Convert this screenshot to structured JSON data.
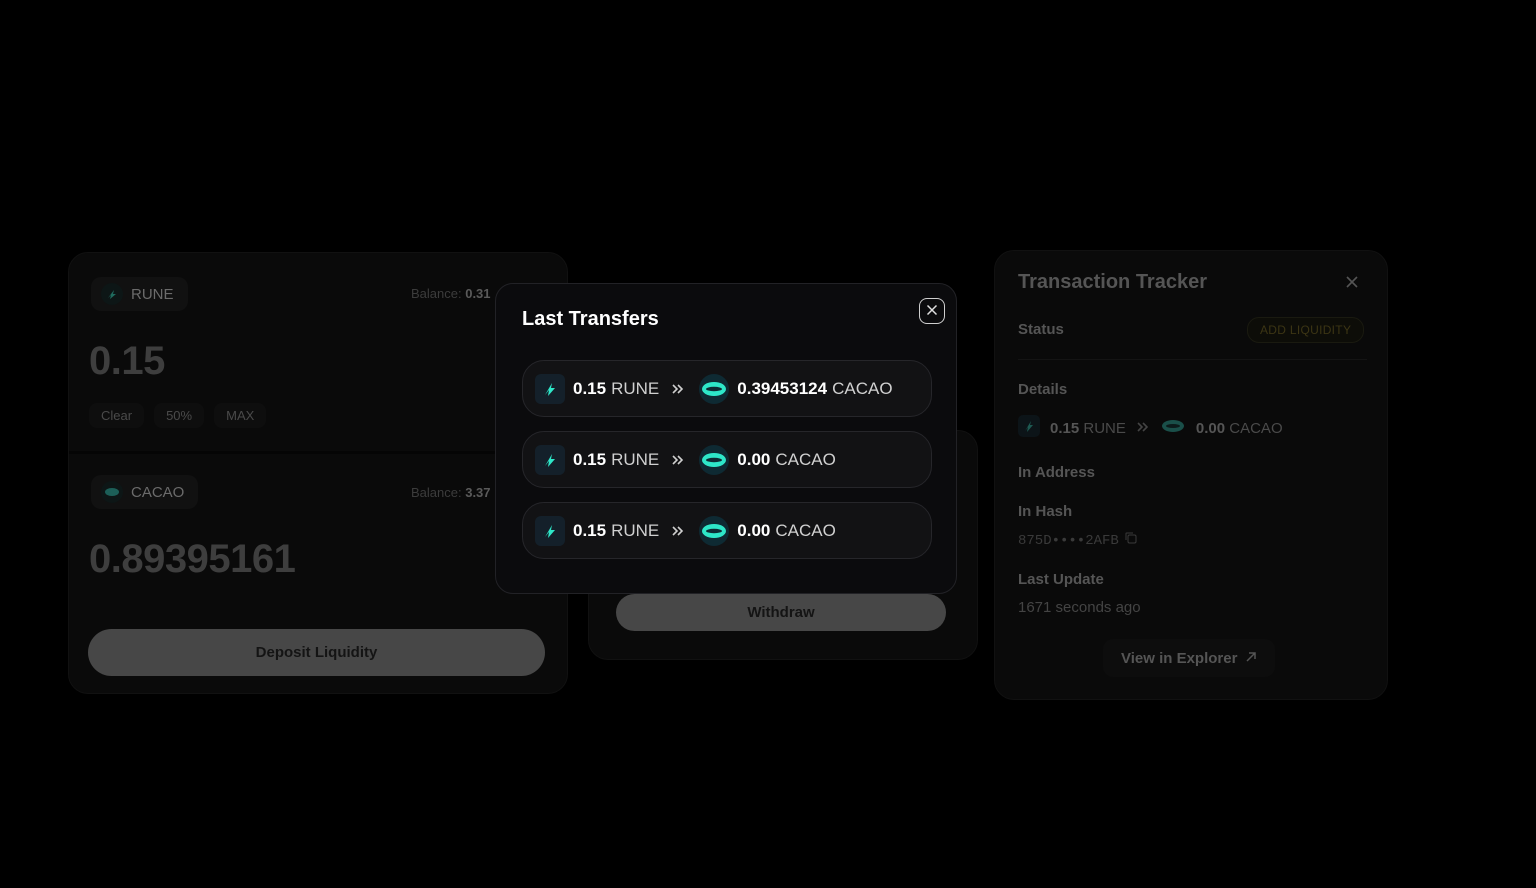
{
  "deposit": {
    "rune_symbol": "RUNE",
    "rune_balance_label": "Balance:",
    "rune_balance_value": "0.31",
    "rune_amount": "0.15",
    "quick": [
      "Clear",
      "50%",
      "MAX"
    ],
    "cacao_symbol": "CACAO",
    "cacao_balance_label": "Balance:",
    "cacao_balance_value": "3.37",
    "cacao_amount": "0.89395161",
    "button": "Deposit Liquidity"
  },
  "withdraw": {
    "button": "Withdraw"
  },
  "tracker": {
    "title": "Transaction Tracker",
    "status_label": "Status",
    "status_badge": "ADD LIQUIDITY",
    "details_label": "Details",
    "details_from_amount": "0.15",
    "details_from_symbol": "RUNE",
    "details_to_amount": "0.00",
    "details_to_symbol": "CACAO",
    "in_address_label": "In Address",
    "in_hash_label": "In Hash",
    "in_hash_value": "875D••••2AFB",
    "last_update_label": "Last Update",
    "last_update_value": "1671 seconds ago",
    "explorer_button": "View in Explorer"
  },
  "modal": {
    "title": "Last Transfers",
    "transfers": [
      {
        "from_amount": "0.15",
        "from_symbol": "RUNE",
        "to_amount": "0.39453124",
        "to_symbol": "CACAO"
      },
      {
        "from_amount": "0.15",
        "from_symbol": "RUNE",
        "to_amount": "0.00",
        "to_symbol": "CACAO"
      },
      {
        "from_amount": "0.15",
        "from_symbol": "RUNE",
        "to_amount": "0.00",
        "to_symbol": "CACAO"
      }
    ]
  },
  "icons": {
    "rune": "rune-bolt-icon",
    "cacao": "cacao-disc-icon",
    "arrow": "double-chevron-right-icon",
    "close": "close-icon",
    "copy": "copy-icon",
    "external": "external-link-icon"
  },
  "colors": {
    "accent": "#2ee6c8",
    "background": "#000000",
    "modal_bg": "#0b0b0d"
  }
}
